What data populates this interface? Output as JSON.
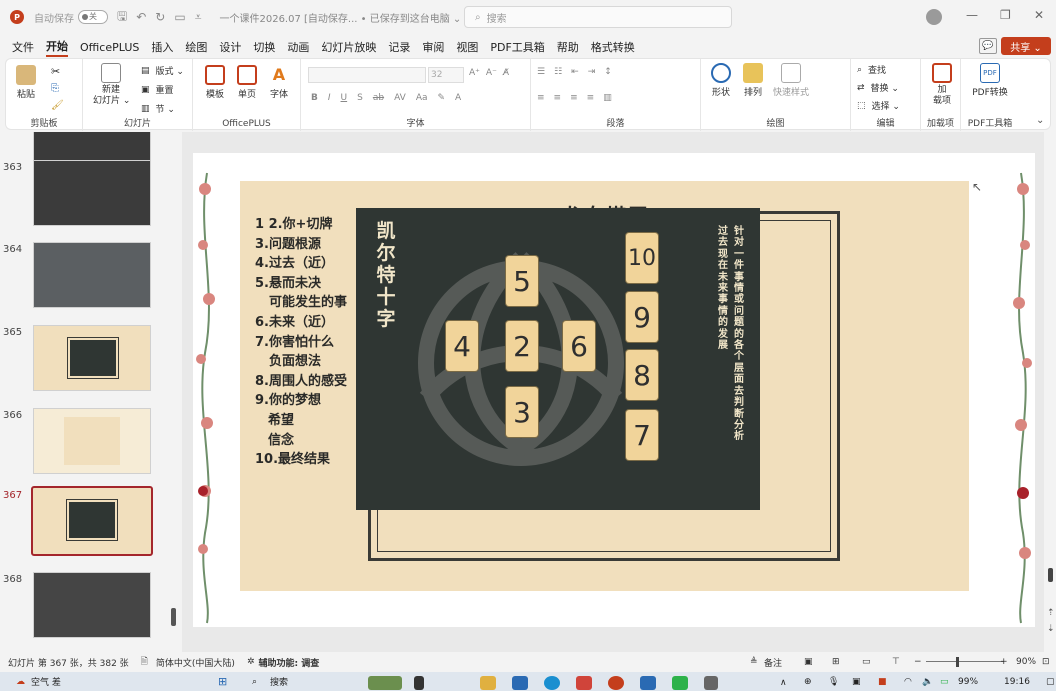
{
  "titlebar": {
    "autosave_label": "自动保存",
    "toggle_state": "关",
    "doc_title": "一个课件2026.07 [自动保存...  •  已保存到这台电脑 ⌄",
    "search_placeholder": "搜索",
    "minimize": "—",
    "restore": "❐",
    "close": "✕"
  },
  "menu": {
    "tabs": [
      "文件",
      "开始",
      "OfficePLUS",
      "插入",
      "绘图",
      "设计",
      "切换",
      "动画",
      "幻灯片放映",
      "记录",
      "审阅",
      "视图",
      "PDF工具箱",
      "帮助",
      "格式转换"
    ],
    "active": "开始",
    "share_label": "共享 ⌄"
  },
  "ribbon": {
    "clipboard": {
      "paste": "粘贴",
      "label": "剪贴板"
    },
    "slides": {
      "new_slide": "新建\n幻灯片 ⌄",
      "layout": "版式 ⌄",
      "reset": "重置",
      "section": "节 ⌄",
      "label": "幻灯片"
    },
    "officeplus": {
      "template": "模板",
      "single": "单页",
      "font": "字体",
      "label": "OfficePLUS"
    },
    "font": {
      "size": "32",
      "label": "字体"
    },
    "paragraph": {
      "label": "段落"
    },
    "drawing": {
      "shape": "形状",
      "arrange": "排列",
      "quick_styles": "快速样式",
      "label": "绘图"
    },
    "editing": {
      "find": "查找",
      "replace": "替换 ⌄",
      "select": "选择 ⌄",
      "label": "编辑"
    },
    "addins": {
      "addin": "加\n载项",
      "label": "加载项"
    },
    "pdf": {
      "convert": "PDF转换",
      "label": "PDF工具箱"
    }
  },
  "thumbnails": [
    {
      "num": "363"
    },
    {
      "num": "364"
    },
    {
      "num": "365"
    },
    {
      "num": "366"
    },
    {
      "num": "367",
      "selected": true
    },
    {
      "num": "368"
    }
  ],
  "slide": {
    "title": "龙女塔罗",
    "vertical_title": [
      "凯",
      "尔",
      "特",
      "十",
      "字"
    ],
    "vertical_desc_1": [
      "针",
      "对",
      "一",
      "件",
      "事",
      "情",
      "或",
      "问",
      "题",
      "的",
      "各",
      "个",
      "层",
      "面",
      "去",
      "判",
      "断",
      "分",
      "析"
    ],
    "vertical_desc_2": [
      "过",
      "去",
      "现",
      "在",
      "未",
      "来",
      "事",
      "情",
      "的",
      "发",
      "展"
    ],
    "list": [
      {
        "text": "1  2.你+切牌",
        "cls": ""
      },
      {
        "text": "3.问题根源",
        "cls": ""
      },
      {
        "text": "4.过去（近）",
        "cls": ""
      },
      {
        "text": "5.悬而未决",
        "cls": ""
      },
      {
        "text": "可能发生的事",
        "cls": "indent"
      },
      {
        "text": "6.未来（近）",
        "cls": ""
      },
      {
        "text": "7.你害怕什么",
        "cls": ""
      },
      {
        "text": "负面想法",
        "cls": "indent"
      },
      {
        "text": "8.周围人的感受",
        "cls": ""
      },
      {
        "text": "9.你的梦想",
        "cls": ""
      },
      {
        "text": "希望",
        "cls": "indent2"
      },
      {
        "text": "信念",
        "cls": "indent2"
      },
      {
        "text": "10.最终结果",
        "cls": ""
      }
    ],
    "cards": [
      "5",
      "4",
      "2",
      "6",
      "3",
      "10",
      "9",
      "8",
      "7"
    ]
  },
  "statusbar": {
    "slide_info": "幻灯片 第 367 张，共 382 张",
    "language": "简体中文(中国大陆)",
    "accessibility": "辅助功能: 调查",
    "notes": "备注",
    "zoom": "90%"
  },
  "taskbar": {
    "weather_temp": "空气 差",
    "search": "搜索",
    "battery": "99%",
    "time": "19:16"
  },
  "colors": {
    "accent": "#c43e1c",
    "selected": "#a4262c",
    "beige": "#f1dfbd",
    "board": "#2f3633",
    "card": "#f1d49a"
  }
}
